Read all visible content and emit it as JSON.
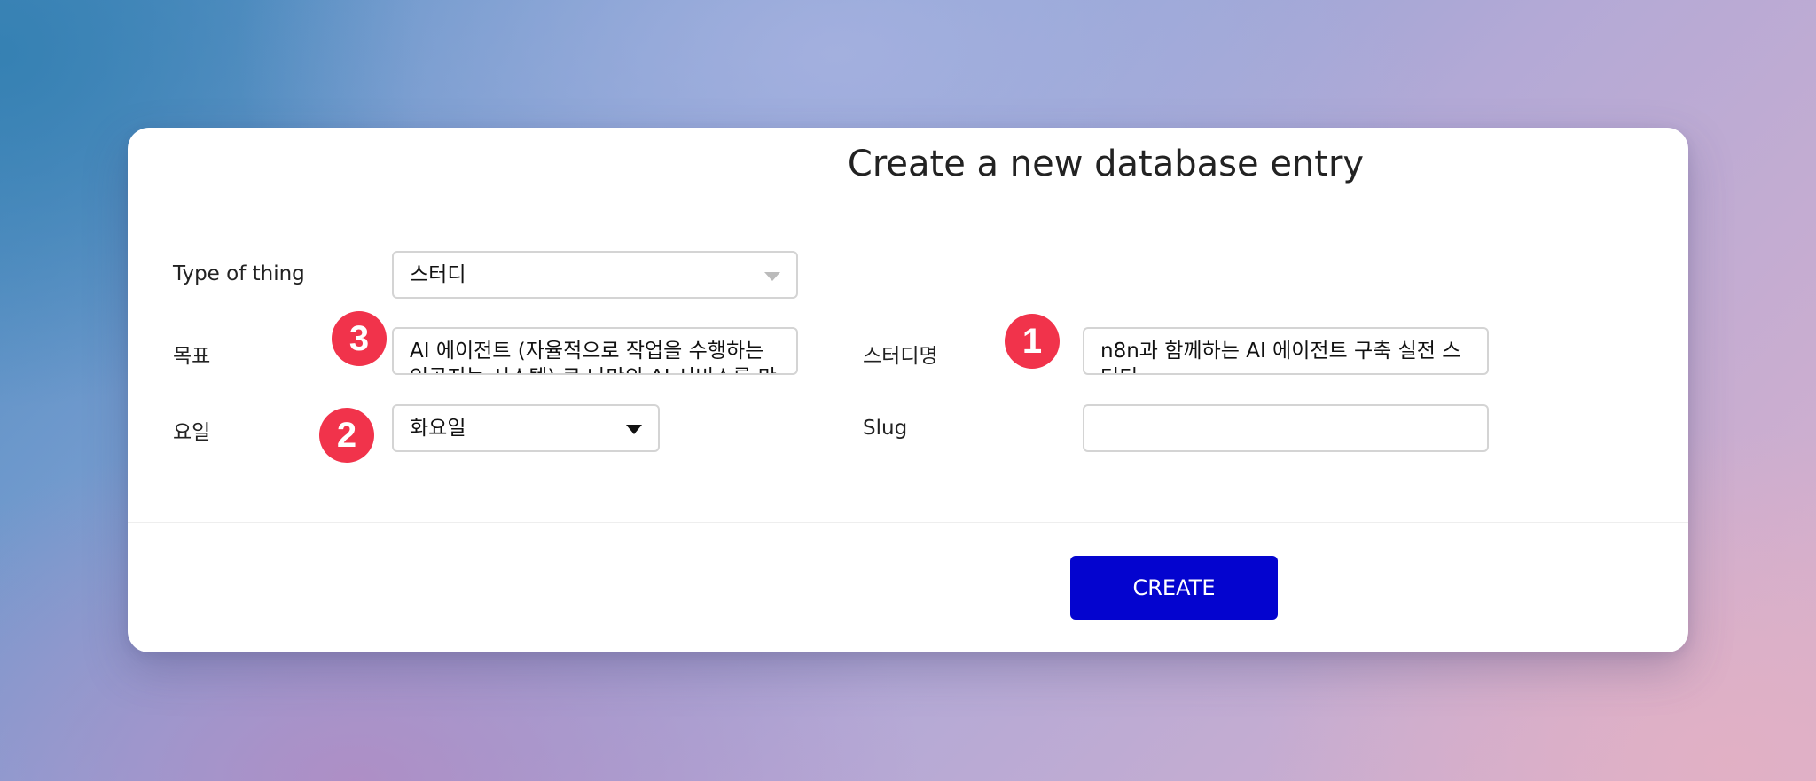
{
  "title": "Create a new database entry",
  "form": {
    "type_of_thing": {
      "label": "Type of thing",
      "value": "스터디"
    },
    "goal": {
      "label": "목표",
      "value": "AI 에이전트 (자율적으로 작업을 수행하는 인공지능 시스템) 로 나만의 AI 서비스를 만"
    },
    "day": {
      "label": "요일",
      "value": "화요일"
    },
    "study_name": {
      "label": "스터디명",
      "value_main": "n8n과 함께하는 AI 에이전트 구축 실전 스",
      "value_tail": "터디"
    },
    "slug": {
      "label": "Slug",
      "value": ""
    }
  },
  "badges": {
    "one": "1",
    "two": "2",
    "three": "3"
  },
  "buttons": {
    "create": "CREATE"
  },
  "colors": {
    "badge": "#f1334b",
    "create_button": "#0404cf"
  },
  "icons": {
    "type_dropdown": "chevron-down-icon",
    "day_dropdown": "caret-down-icon"
  }
}
